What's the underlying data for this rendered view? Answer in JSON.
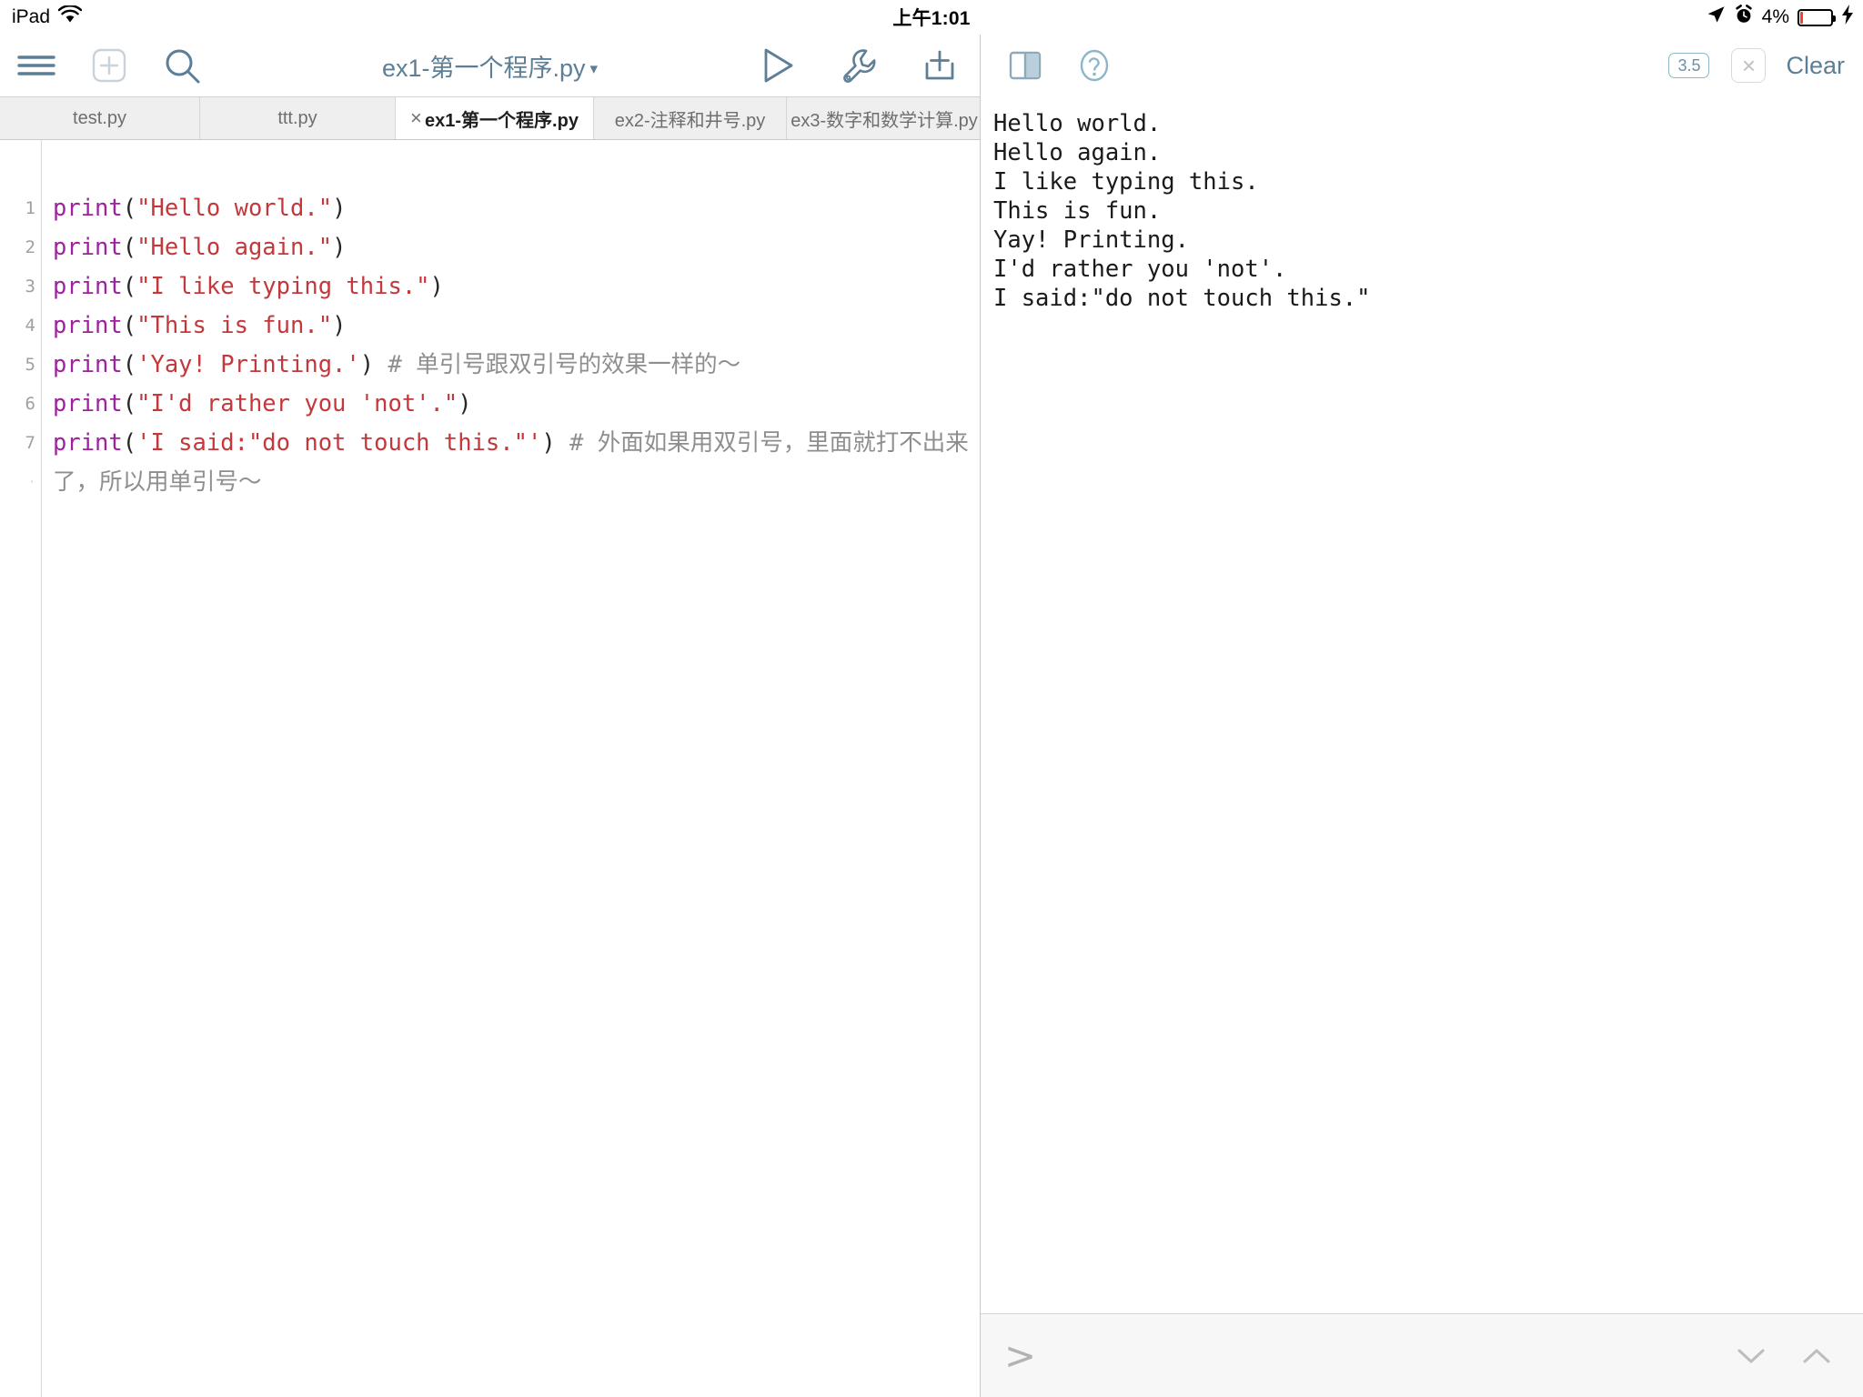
{
  "statusbar": {
    "device": "iPad",
    "wifi_icon": "wifi-icon",
    "time": "上午1:01",
    "location_icon": "location-arrow-icon",
    "alarm_icon": "alarm-clock-icon",
    "battery_percent": "4%",
    "battery_icon": "battery-icon",
    "charging_icon": "lightning-bolt-icon",
    "battery_level_color": "#ff3b30"
  },
  "toolbar": {
    "menu_icon": "hamburger-menu-icon",
    "new_file_icon": "new-file-plus-icon",
    "search_icon": "search-icon",
    "title": "ex1-第一个程序.py",
    "title_caret": "▾",
    "run_icon": "run-play-icon",
    "tools_icon": "wrench-tools-icon",
    "share_icon": "share-export-icon",
    "accent_color": "#5c7f96"
  },
  "tabs": {
    "items": [
      {
        "label": "test.py",
        "active": false,
        "closable": false
      },
      {
        "label": "ttt.py",
        "active": false,
        "closable": false
      },
      {
        "label": "ex1-第一个程序.py",
        "active": true,
        "closable": true,
        "close_glyph": "×"
      },
      {
        "label": "ex2-注释和井号.py",
        "active": false,
        "closable": false
      },
      {
        "label": "ex3-数字和数学计算.py",
        "active": false,
        "closable": false
      }
    ]
  },
  "editor": {
    "line_numbers": [
      "1",
      "2",
      "3",
      "4",
      "5",
      "6",
      "7",
      "·"
    ],
    "lines": [
      {
        "n": "1",
        "call": "print",
        "open": "(",
        "string": "\"Hello world.\"",
        "close": ")",
        "comment": ""
      },
      {
        "n": "2",
        "call": "print",
        "open": "(",
        "string": "\"Hello again.\"",
        "close": ")",
        "comment": ""
      },
      {
        "n": "3",
        "call": "print",
        "open": "(",
        "string": "\"I like typing this.\"",
        "close": ")",
        "comment": ""
      },
      {
        "n": "4",
        "call": "print",
        "open": "(",
        "string": "\"This is fun.\"",
        "close": ")",
        "comment": ""
      },
      {
        "n": "5",
        "call": "print",
        "open": "(",
        "string": "'Yay! Printing.'",
        "close": ")",
        "comment": " # 单引号跟双引号的效果一样的～"
      },
      {
        "n": "6",
        "call": "print",
        "open": "(",
        "string": "\"I'd rather you 'not'.\"",
        "close": ")",
        "comment": ""
      },
      {
        "n": "7",
        "call": "print",
        "open": "(",
        "string": "'I said:\"do not touch this.\"'",
        "close": ")",
        "comment": " # 外面如果用双引号，里面就打不出来了，所以用单引号～"
      }
    ],
    "colors": {
      "keyword": "#a021a0",
      "string": "#c4383c",
      "punct": "#262626",
      "comment": "#8e8e8e"
    }
  },
  "console": {
    "layout_icon": "split-panel-icon",
    "help_icon": "help-question-icon",
    "version_badge": "3.5",
    "close_icon": "×",
    "clear_label": "Clear",
    "output": "Hello world.\nHello again.\nI like typing this.\nThis is fun.\nYay! Printing.\nI'd rather you 'not'.\nI said:\"do not touch this.\"",
    "prompt": ">",
    "input_value": "",
    "input_placeholder": "",
    "down_icon": "chevron-down-icon",
    "up_icon": "chevron-up-icon"
  }
}
